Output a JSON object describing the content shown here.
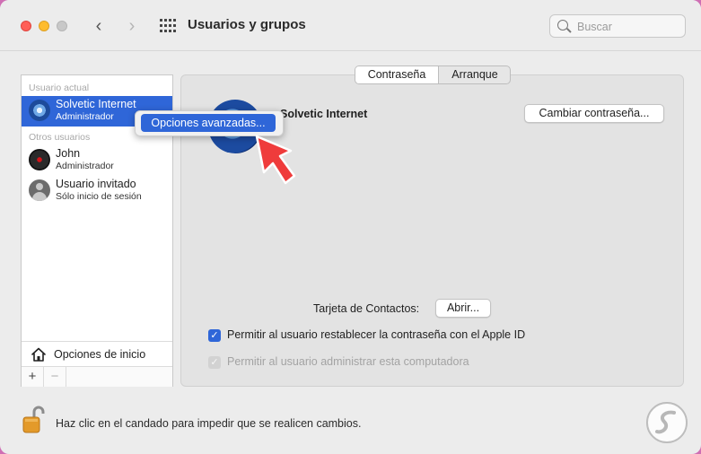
{
  "window": {
    "title": "Usuarios y grupos"
  },
  "search": {
    "placeholder": "Buscar"
  },
  "sidebar": {
    "current_user_label": "Usuario actual",
    "other_users_label": "Otros usuarios",
    "users": [
      {
        "name": "Solvetic Internet",
        "role": "Administrador",
        "selected": true
      },
      {
        "name": "John",
        "role": "Administrador",
        "selected": false
      },
      {
        "name": "Usuario invitado",
        "role": "Sólo inicio de sesión",
        "selected": false
      }
    ],
    "login_options_label": "Opciones de inicio",
    "add_label": "+",
    "remove_label": "−"
  },
  "context_menu": {
    "item": "Opciones avanzadas..."
  },
  "tabs": [
    {
      "label": "Contraseña",
      "active": true
    },
    {
      "label": "Arranque",
      "active": false
    }
  ],
  "user_detail": {
    "name": "Solvetic Internet",
    "change_password_button": "Cambiar contraseña...",
    "contacts_card_label": "Tarjeta de Contactos:",
    "open_button": "Abrir...",
    "allow_reset_label": "Permitir al usuario restablecer la contraseña con el Apple ID",
    "allow_reset_checked": true,
    "allow_admin_label": "Permitir al usuario administrar esta computadora",
    "allow_admin_checked": true
  },
  "footer": {
    "lock_text": "Haz clic en el candado para impedir que se realicen cambios."
  },
  "colors": {
    "accent": "#2f66d8",
    "annotation_arrow": "#ef3b3b"
  }
}
